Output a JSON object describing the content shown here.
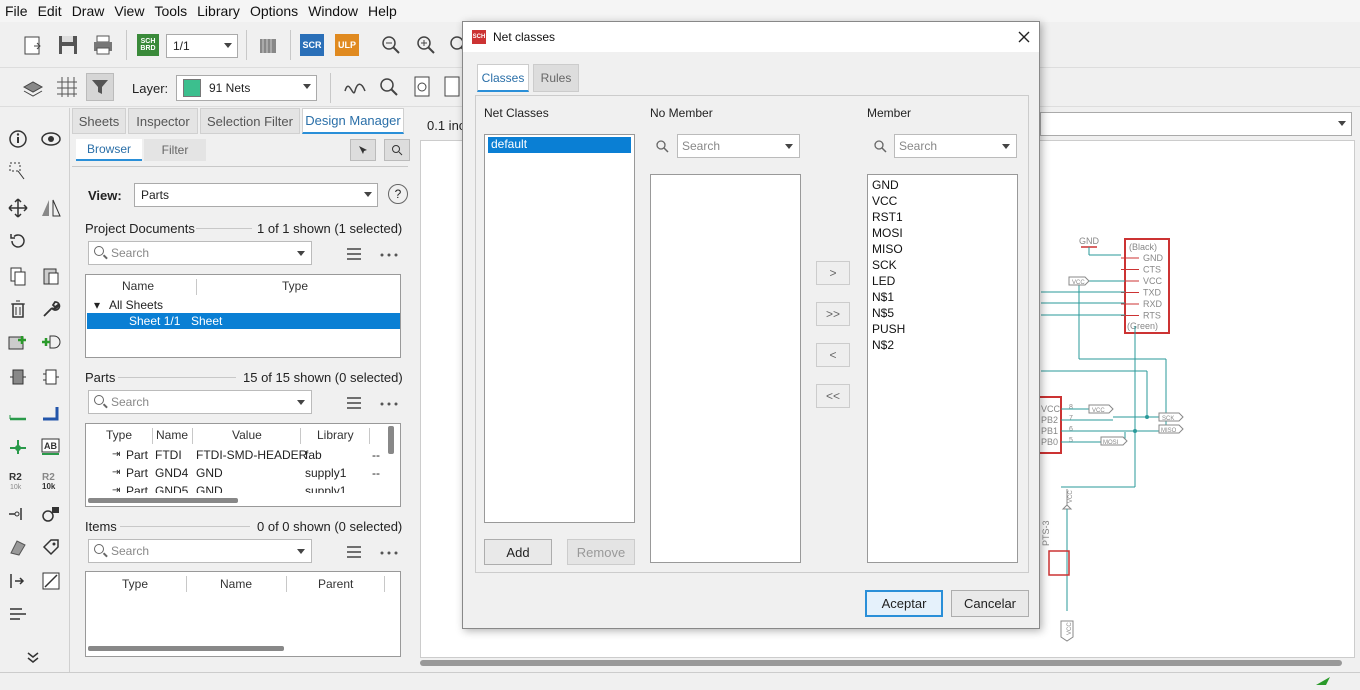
{
  "menu": [
    "File",
    "Edit",
    "Draw",
    "View",
    "Tools",
    "Library",
    "Options",
    "Window",
    "Help"
  ],
  "toolbar": {
    "sheet_value": "1/1",
    "layer_label": "Layer:",
    "layer_value": "91 Nets",
    "layer_color": "#3cbf8e",
    "brd_label": "BRD",
    "sch_label": "SCH",
    "scr_label": "SCR",
    "ulp_label": "ULP"
  },
  "panel": {
    "tabs": [
      "Sheets",
      "Inspector",
      "Selection Filter",
      "Design Manager"
    ],
    "subtabs": [
      "Browser",
      "Filter"
    ],
    "view_label": "View:",
    "view_value": "Parts",
    "help": "?",
    "project_docs": {
      "title": "Project Documents",
      "count": "1 of 1 shown (1 selected)",
      "search_placeholder": "Search",
      "columns": [
        "Name",
        "Type"
      ],
      "group": "All Sheets",
      "row": {
        "name": "Sheet 1/1",
        "type": "Sheet"
      }
    },
    "parts": {
      "title": "Parts",
      "count": "15 of 15 shown (0 selected)",
      "search_placeholder": "Search",
      "columns": [
        "Type",
        "Name",
        "Value",
        "Library"
      ],
      "rows": [
        {
          "type": "Part",
          "name": "FTDI",
          "value": "FTDI-SMD-HEADER",
          "library": "fab",
          "extra": "--"
        },
        {
          "type": "Part",
          "name": "GND4",
          "value": "GND",
          "library": "supply1",
          "extra": "--"
        },
        {
          "type": "Part",
          "name": "GND5",
          "value": "GND",
          "library": "supply1",
          "extra": ""
        }
      ]
    },
    "items": {
      "title": "Items",
      "count": "0 of 0 shown (0 selected)",
      "search_placeholder": "Search",
      "columns": [
        "Type",
        "Name",
        "Parent"
      ]
    }
  },
  "canvas": {
    "coord_text": "0.1 inc",
    "labels": {
      "gnd": "GND",
      "black": "(Black)",
      "green": "(Green)",
      "ftdi_pins": [
        "GND",
        "CTS",
        "VCC",
        "TXD",
        "RXD",
        "RTS"
      ],
      "vcc": "VCC",
      "mcu_pins": [
        "VCC",
        "PB2",
        "PB1",
        "PB0"
      ],
      "pin_nums": [
        "8",
        "7",
        "6",
        "5"
      ],
      "sck": "SCK",
      "miso": "MISO",
      "mosi": "MOSI",
      "pts": "PTS-3"
    }
  },
  "dialog": {
    "title": "Net classes",
    "icon_label": "SCH",
    "tabs": [
      "Classes",
      "Rules"
    ],
    "net_classes_label": "Net Classes",
    "net_classes": [
      "default"
    ],
    "no_member_label": "No Member",
    "member_label": "Member",
    "search_placeholder": "Search",
    "members": [
      "GND",
      "VCC",
      "RST1",
      "MOSI",
      "MISO",
      "SCK",
      "LED",
      "N$1",
      "N$5",
      "PUSH",
      "N$2"
    ],
    "move_buttons": [
      ">",
      ">>",
      "<",
      "<<"
    ],
    "add": "Add",
    "remove": "Remove",
    "accept": "Aceptar",
    "cancel": "Cancelar"
  }
}
